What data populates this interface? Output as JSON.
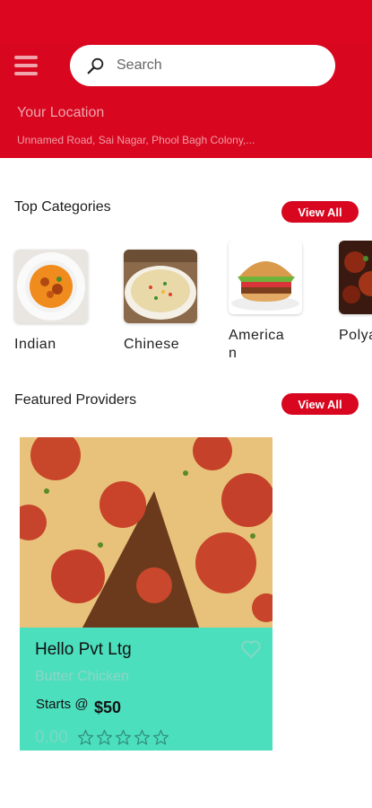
{
  "search": {
    "placeholder": "Search"
  },
  "location": {
    "title": "Your Location",
    "address": "Unnamed Road, Sai Nagar, Phool Bagh Colony,..."
  },
  "top_categories": {
    "title": "Top Categories",
    "view_all": "View All",
    "items": [
      {
        "label": "Indian"
      },
      {
        "label": "Chinese"
      },
      {
        "label": "American"
      },
      {
        "label": "Polyan"
      }
    ]
  },
  "featured": {
    "title": "Featured Providers",
    "view_all": "View All",
    "providers": [
      {
        "name": "Hello Pvt Ltg",
        "dish": "Butter Chicken",
        "starts_label": "Starts @",
        "price": "$50",
        "rating": "0.00",
        "stars_filled": 0,
        "stars_total": 5
      }
    ]
  },
  "colors": {
    "brand_red": "#d8061f",
    "card_teal": "#4cdfbd"
  },
  "icons": [
    "menu-icon",
    "search-icon",
    "heart-icon",
    "star-icon"
  ]
}
